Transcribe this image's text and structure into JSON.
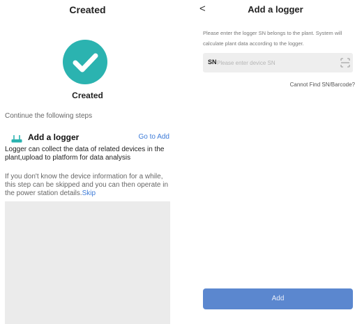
{
  "left": {
    "title": "Created",
    "status_label": "Created",
    "continue_text": "Continue the following steps",
    "step": {
      "icon": "router-icon",
      "title": "Add a logger",
      "action": "Go to Add",
      "description": "Logger can collect the data of related devices in the plant,upload to platform for data analysis"
    },
    "skip_text": "If you don't know the device information for a while, this step can be skipped and you can then operate in the power station details.",
    "skip_link": "Skip"
  },
  "right": {
    "back_icon": "chevron-left-icon",
    "back_glyph": "<",
    "title": "Add a logger",
    "description": "Please enter the logger SN belongs to the plant. System will calculate plant data according to the logger.",
    "sn_label": "SN",
    "sn_placeholder": "Please enter device SN",
    "sn_value": "",
    "scan_icon": "scan-icon",
    "cannot_find": "Cannot Find SN/Barcode?",
    "add_button": "Add"
  },
  "colors": {
    "success": "#2bb3b0",
    "link": "#3d7bd8",
    "primary_button": "#5b87cf",
    "placeholder_block": "#ebebeb"
  }
}
